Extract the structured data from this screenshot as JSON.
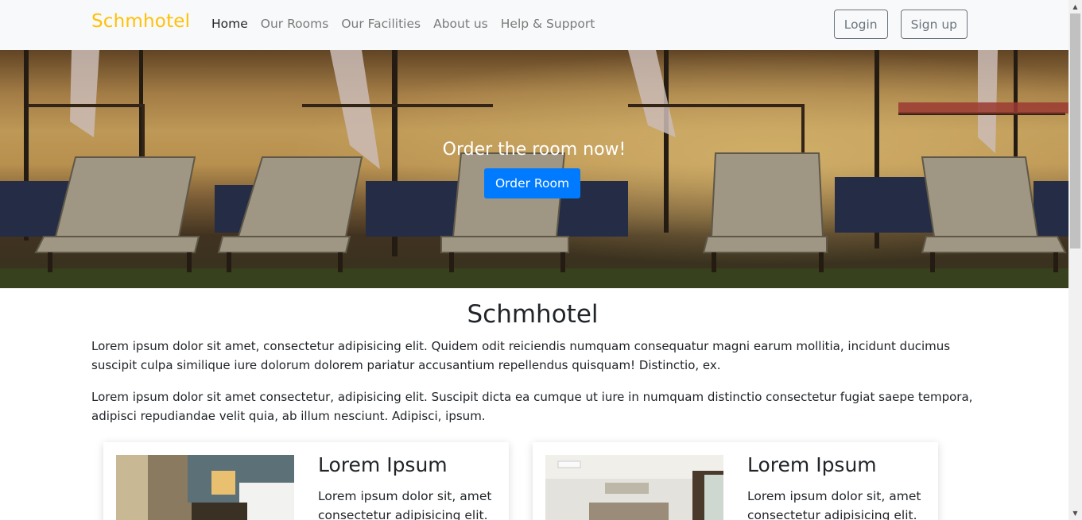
{
  "brand": "Schmhotel",
  "nav": {
    "items": [
      "Home",
      "Our Rooms",
      "Our Facilities",
      "About us",
      "Help & Support"
    ],
    "active": "Home"
  },
  "auth": {
    "login": "Login",
    "signup": "Sign up"
  },
  "hero": {
    "title": "Order the room now!",
    "button": "Order Room"
  },
  "about": {
    "heading": "Schmhotel",
    "paragraphs": [
      "Lorem ipsum dolor sit amet, consectetur adipisicing elit. Quidem odit reiciendis numquam consequatur magni earum mollitia, incidunt ducimus suscipit culpa similique iure dolorum dolorem pariatur accusantium repellendus quisquam! Distinctio, ex.",
      "Lorem ipsum dolor sit amet consectetur, adipisicing elit. Suscipit dicta ea cumque ut iure in numquam distinctio consectetur fugiat saepe tempora, adipisci repudiandae velit quia, ab illum nesciunt. Adipisci, ipsum."
    ]
  },
  "cards": [
    {
      "title": "Lorem Ipsum",
      "text": "Lorem ipsum dolor sit, amet consectetur adipisicing elit."
    },
    {
      "title": "Lorem Ipsum",
      "text": "Lorem ipsum dolor sit, amet consectetur adipisicing elit."
    }
  ],
  "colors": {
    "brand": "#ffc107",
    "primary": "#007bff",
    "navbar_bg": "#f8f9fa"
  }
}
